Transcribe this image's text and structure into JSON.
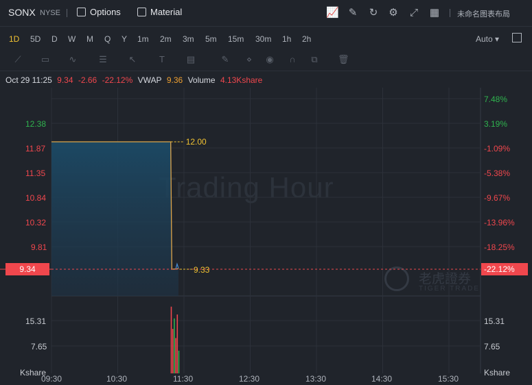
{
  "header": {
    "symbol": "SONX",
    "exchange": "NYSE",
    "options_label": "Options",
    "material_label": "Material",
    "layout_name": "未命名图表布局"
  },
  "timeframes": [
    "1D",
    "5D",
    "D",
    "W",
    "M",
    "Q",
    "Y",
    "1m",
    "2m",
    "3m",
    "5m",
    "15m",
    "30m",
    "1h",
    "2h"
  ],
  "active_timeframe": "1D",
  "scale_mode": "Auto",
  "info": {
    "datetime": "Oct 29 11:25",
    "price": "9.34",
    "change": "-2.66",
    "change_pct": "-22.12%",
    "vwap_label": "VWAP",
    "vwap": "9.36",
    "volume_label": "Volume",
    "volume": "4.13Kshare"
  },
  "watermark": "Trading Hour",
  "brand": {
    "cn": "老虎證券",
    "en": "TIGER TRADE"
  },
  "colors": {
    "up": "#2fb34e",
    "down": "#f0474d",
    "accent": "#f1c232",
    "price_line": "#f0a030"
  },
  "chart_data": {
    "type": "area",
    "price_axis_left": [
      "12.38",
      "11.87",
      "11.35",
      "10.84",
      "10.32",
      "9.81"
    ],
    "pct_axis_right": [
      "7.48%",
      "3.19%",
      "-1.09%",
      "-5.38%",
      "-9.67%",
      "-13.96%",
      "-18.25%"
    ],
    "last_price_tag": "9.34",
    "last_pct_tag": "-22.12%",
    "prev_close_label": "12.00",
    "last_label": "9.33",
    "volume_axis": [
      "15.31",
      "7.65"
    ],
    "volume_unit": "Kshare",
    "x_ticks": [
      "09:30",
      "10:30",
      "11:30",
      "12:30",
      "13:30",
      "14:30",
      "15:30"
    ],
    "series": [
      {
        "x": [
          "09:30",
          "11:18",
          "11:19",
          "11:25"
        ],
        "values": [
          12.0,
          12.0,
          9.33,
          9.34
        ]
      }
    ],
    "volume": {
      "times": [
        "11:18",
        "11:19",
        "11:20",
        "11:21",
        "11:22",
        "11:23"
      ],
      "values": [
        15.3,
        10.2,
        12.6,
        8.1,
        13.5,
        5.2
      ],
      "colors": [
        "down",
        "down",
        "up",
        "down",
        "down",
        "up"
      ]
    },
    "ylim": [
      9.2,
      12.6
    ],
    "grid": true
  }
}
